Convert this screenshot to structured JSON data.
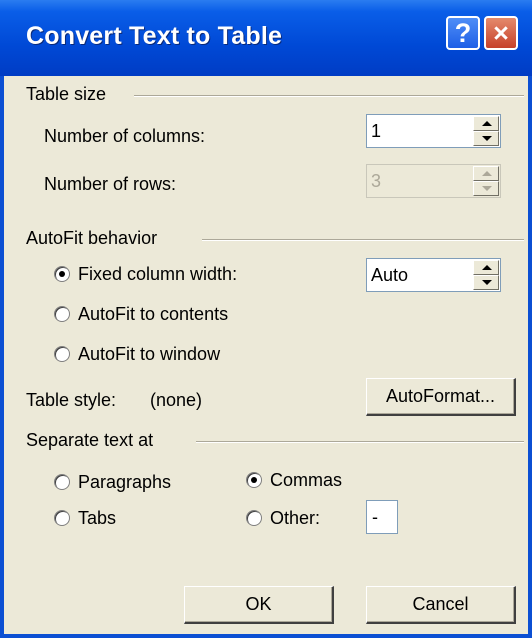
{
  "window": {
    "title": "Convert Text to Table",
    "help_glyph": "?",
    "close_glyph": "×"
  },
  "table_size": {
    "heading": "Table size",
    "columns_label": "Number of columns:",
    "columns_value": "1",
    "rows_label": "Number of rows:",
    "rows_value": "3"
  },
  "autofit": {
    "heading": "AutoFit behavior",
    "fixed_label": "Fixed column width:",
    "fixed_value": "Auto",
    "contents_label": "AutoFit to contents",
    "window_label": "AutoFit to window",
    "selected": "fixed"
  },
  "table_style": {
    "label": "Table style:",
    "value": "(none)",
    "autoformat_button": "AutoFormat..."
  },
  "separate": {
    "heading": "Separate text at",
    "paragraphs_label": "Paragraphs",
    "commas_label": "Commas",
    "tabs_label": "Tabs",
    "other_label": "Other:",
    "other_value": "-",
    "selected": "commas"
  },
  "buttons": {
    "ok": "OK",
    "cancel": "Cancel"
  },
  "colors": {
    "titlebar": "#0049d6",
    "dialog_bg": "#ece9d8",
    "close_button": "#c6412a"
  }
}
